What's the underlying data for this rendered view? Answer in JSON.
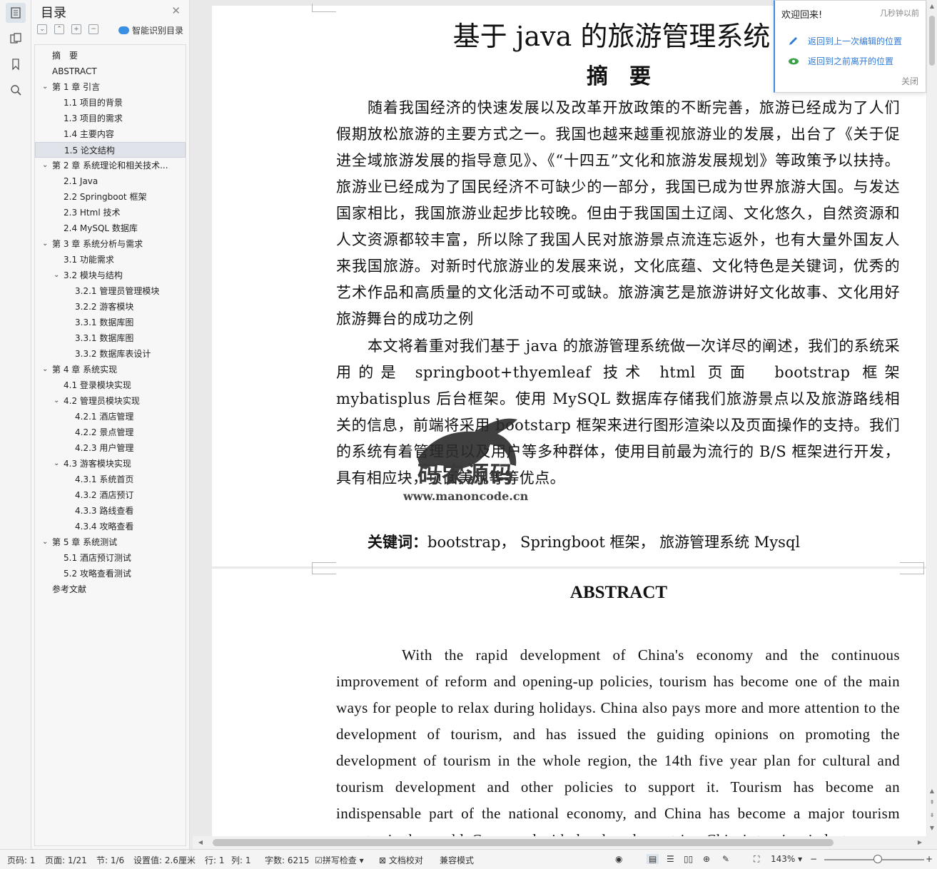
{
  "sidebar_rail": {
    "icons": [
      "outline-icon",
      "pages-icon",
      "bookmark-icon",
      "search-icon"
    ]
  },
  "toc": {
    "title": "目录",
    "smart_label": "智能识别目录",
    "items": [
      {
        "text": "摘　要",
        "level": 0,
        "caret": ""
      },
      {
        "text": "ABSTRACT",
        "level": 0,
        "caret": ""
      },
      {
        "text": "第 1 章  引言",
        "level": 0,
        "caret": "v"
      },
      {
        "text": "1.1  项目的背景",
        "level": 1,
        "caret": ""
      },
      {
        "text": "1.3  项目的需求",
        "level": 1,
        "caret": ""
      },
      {
        "text": "1.4  主要内容",
        "level": 1,
        "caret": ""
      },
      {
        "text": "1.5  论文结构",
        "level": 1,
        "caret": "",
        "selected": true
      },
      {
        "text": "第 2 章  系统理论和相关技术...",
        "level": 0,
        "caret": "v"
      },
      {
        "text": "2.1 Java",
        "level": 1,
        "caret": ""
      },
      {
        "text": "2.2 Springboot 框架",
        "level": 1,
        "caret": ""
      },
      {
        "text": "2.3 Html 技术",
        "level": 1,
        "caret": ""
      },
      {
        "text": "2.4 MySQL 数据库",
        "level": 1,
        "caret": ""
      },
      {
        "text": "第 3 章  系统分析与需求",
        "level": 0,
        "caret": "v"
      },
      {
        "text": "3.1 功能需求",
        "level": 1,
        "caret": ""
      },
      {
        "text": "3.2  模块与结构",
        "level": 1,
        "caret": "v"
      },
      {
        "text": "3.2.1  管理员管理模块",
        "level": 2,
        "caret": ""
      },
      {
        "text": "3.2.2  游客模块",
        "level": 2,
        "caret": ""
      },
      {
        "text": "3.3.1  数据库图",
        "level": 2,
        "caret": ""
      },
      {
        "text": "3.3.1  数据库图",
        "level": 2,
        "caret": ""
      },
      {
        "text": "3.3.2 数据库表设计",
        "level": 2,
        "caret": ""
      },
      {
        "text": "第 4 章  系统实现",
        "level": 0,
        "caret": "v"
      },
      {
        "text": "4.1  登录模块实现",
        "level": 1,
        "caret": ""
      },
      {
        "text": "4.2  管理员模块实现",
        "level": 1,
        "caret": "v"
      },
      {
        "text": "4.2.1  酒店管理",
        "level": 2,
        "caret": ""
      },
      {
        "text": "4.2.2  景点管理",
        "level": 2,
        "caret": ""
      },
      {
        "text": "4.2.3  用户管理",
        "level": 2,
        "caret": ""
      },
      {
        "text": "4.3  游客模块实现",
        "level": 1,
        "caret": "v"
      },
      {
        "text": "4.3.1  系统首页",
        "level": 2,
        "caret": ""
      },
      {
        "text": "4.3.2  酒店预订",
        "level": 2,
        "caret": ""
      },
      {
        "text": "4.3.3  路线查看",
        "level": 2,
        "caret": ""
      },
      {
        "text": "4.3.4  攻略查看",
        "level": 2,
        "caret": ""
      },
      {
        "text": "第 5 章  系统测试",
        "level": 0,
        "caret": "v"
      },
      {
        "text": "5.1  酒店预订测试",
        "level": 1,
        "caret": ""
      },
      {
        "text": "5.2  攻略查看测试",
        "level": 1,
        "caret": ""
      },
      {
        "text": "参考文献",
        "level": 0,
        "caret": ""
      }
    ]
  },
  "document": {
    "title": "基于 java 的旅游管理系统",
    "abstract_heading": "摘　要",
    "abstract_p1": "随着我国经济的快速发展以及改革开放政策的不断完善，旅游已经成为了人们假期放松旅游的主要方式之一。我国也越来越重视旅游业的发展，出台了《关于促进全域旅游发展的指导意见》、《“十四五”文化和旅游发展规划》等政策予以扶持。旅游业已经成为了国民经济不可缺少的一部分，我国已成为世界旅游大国。与发达国家相比，我国旅游业起步比较晚。但由于我国国土辽阔、文化悠久，自然资源和人文资源都较丰富，所以除了我国人民对旅游景点流连忘返外，也有大量外国友人来我国旅游。对新时代旅游业的发展来说，文化底蕴、文化特色是关键词，优秀的艺术作品和高质量的文化活动不可或缺。旅游演艺是旅游讲好文化故事、文化用好旅游舞台的成功之例",
    "abstract_p2": "本文将着重对我们基于 java 的旅游管理系统做一次详尽的阐述，我们的系统采用的是 springboot+thyemleaf 技术 html 页面　bootstrap 框架　 mybatisplus 后台框架。使用 MySQL 数据库存储我们旅游景点以及旅游路线相关的信息，前端将采用 bootstarp 框架来进行图形渲染以及页面操作的支持。我们的系统有着管理员以及用户等多种群体，使用目前最为流行的 B/S 框架进行开发，具有相应块，页面美观等等优点。",
    "keywords_label": "关键词：",
    "keywords_text": "bootstrap，  Springboot 框架，  旅游管理系统  Mysql",
    "en_heading": "ABSTRACT",
    "en_p1": "With the rapid development of China's economy and the continuous improvement of reform and opening-up policies, tourism has become one of the main ways for people to relax during holidays. China also pays more and more attention to the development of tourism, and has issued the guiding opinions on promoting the development of tourism in the whole region, the 14th five year plan for cultural and tourism development and other policies to support it. Tourism has become an indispensable part of the national economy, and China has become a major tourism country in the world. Compared with developed countries, China's tourism industry"
  },
  "watermark": {
    "text": "码农源码",
    "url": "www.manoncode.cn"
  },
  "popup": {
    "header": "欢迎回来!",
    "time": "几秒钟以前",
    "link1": "返回到上一次编辑的位置",
    "link2": "返回到之前离开的位置",
    "close": "关闭"
  },
  "status_bar": {
    "page_no": "页码: 1",
    "pages": "页面: 1/21",
    "section": "节: 1/6",
    "setting": "设置值: 2.6厘米",
    "row": "行: 1",
    "col": "列: 1",
    "word_count": "字数: 6215",
    "spell_check": "拼写检查",
    "doc_check": "文档校对",
    "compat_mode": "兼容模式",
    "zoom": "143%"
  },
  "colors": {
    "accent": "#3b8fe3",
    "link": "#2f7ad6",
    "page_bg": "#ffffff",
    "canvas_bg": "#e9e9e9"
  }
}
